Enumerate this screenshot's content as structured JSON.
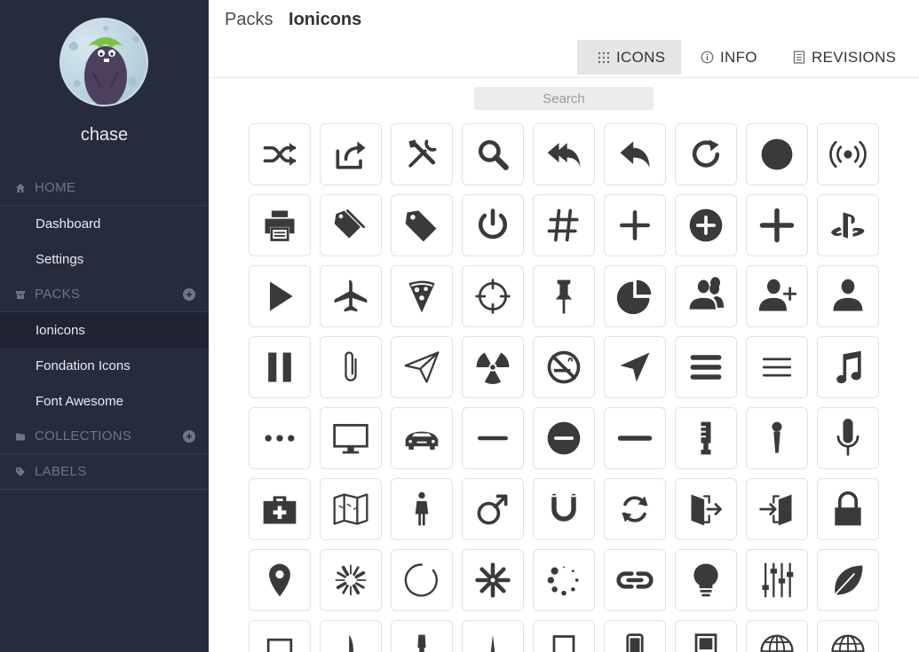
{
  "user": {
    "name": "chase"
  },
  "sidebar": {
    "sections": [
      {
        "label": "HOME",
        "icon": "home-icon"
      },
      {
        "label": "PACKS",
        "icon": "box-icon"
      },
      {
        "label": "COLLECTIONS",
        "icon": "folder-icon"
      },
      {
        "label": "LABELS",
        "icon": "tag-icon"
      }
    ],
    "items": [
      {
        "label": "Dashboard"
      },
      {
        "label": "Settings"
      },
      {
        "label": "Ionicons",
        "active": true
      },
      {
        "label": "Fondation Icons"
      },
      {
        "label": "Font Awesome"
      }
    ]
  },
  "header": {
    "breadcrumb_root": "Packs",
    "breadcrumb_current": "Ionicons",
    "tabs": [
      {
        "label": "ICONS",
        "icon": "grid-icon",
        "active": true
      },
      {
        "label": "INFO",
        "icon": "info-icon"
      },
      {
        "label": "REVISIONS",
        "icon": "document-icon"
      }
    ]
  },
  "search": {
    "placeholder": "Search",
    "value": ""
  },
  "colors": {
    "sidebar": "#272c3d",
    "icon": "#3a3a3a",
    "muted": "#6e7589"
  },
  "icons": [
    "shuffle",
    "share",
    "tools",
    "search",
    "reply-all",
    "reply",
    "refresh",
    "record",
    "radio-waves",
    "printer",
    "pricetags",
    "pricetag",
    "power",
    "pound",
    "plus",
    "plus-circled",
    "plus-round",
    "playstation",
    "play",
    "plane",
    "pizza",
    "pinpoint",
    "pin",
    "pie-graph",
    "person-stalker",
    "person-add",
    "person",
    "pause",
    "paperclip",
    "paper-airplane",
    "nuclear",
    "no-smoking",
    "navigate",
    "navicon-round",
    "navicon",
    "music-note",
    "more",
    "monitor",
    "model-s",
    "minus",
    "minus-circled",
    "minus-round",
    "mic-c",
    "mic-b",
    "mic-a",
    "medkit",
    "map",
    "man",
    "male",
    "magnet",
    "loop",
    "log-out",
    "log-in",
    "locked",
    "location",
    "loading-a",
    "loading-b",
    "loading-c",
    "loading-d",
    "link",
    "lightbulb",
    "levels",
    "leaf",
    "laptop",
    "knife",
    "kitchen",
    "ios-needle",
    "ipad",
    "iphone",
    "ipod",
    "earth",
    "world"
  ]
}
